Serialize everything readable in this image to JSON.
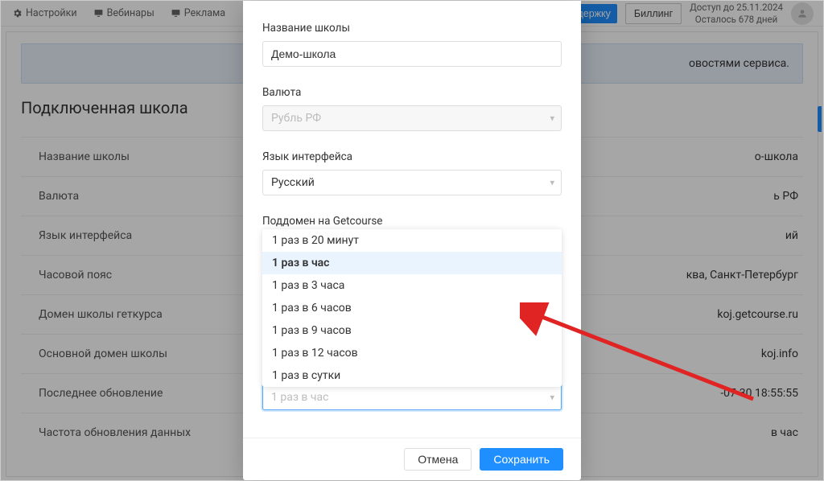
{
  "topbar": {
    "settings": "Настройки",
    "webinars": "Вебинары",
    "ads": "Реклама",
    "support_btn": "в поддержку",
    "billing_btn": "Биллинг",
    "access_line1": "Доступ до 25.11.2024",
    "access_line2": "Осталось 678 дней"
  },
  "banner_text": "овостями сервиса.",
  "page_title": "Подключенная школа",
  "rows": [
    {
      "label": "Название школы",
      "value": "о-школа"
    },
    {
      "label": "Валюта",
      "value": "ь РФ"
    },
    {
      "label": "Язык интерфейса",
      "value": "ий"
    },
    {
      "label": "Часовой пояс",
      "value": "ква, Санкт-Петербург"
    },
    {
      "label": "Домен школы геткурса",
      "value": "koj.getcourse.ru"
    },
    {
      "label": "Основной домен школы",
      "value": "koj.info"
    },
    {
      "label": "Последнее обновление",
      "value": "-07-30 18:55:55"
    },
    {
      "label": "Частота обновления данных",
      "value": "в час"
    }
  ],
  "modal": {
    "school_label": "Название школы",
    "school_value": "Демо-школа",
    "currency_label": "Валюта",
    "currency_value": "Рубль РФ",
    "lang_label": "Язык интерфейса",
    "lang_value": "Русский",
    "subdomain_label": "Поддомен на Getcourse",
    "freq_placeholder": "1 раз в час",
    "options": [
      "1 раз в 20 минут",
      "1 раз в час",
      "1 раз в 3 часа",
      "1 раз в 6 часов",
      "1 раз в 9 часов",
      "1 раз в 12 часов",
      "1 раз в сутки"
    ],
    "cancel": "Отмена",
    "save": "Сохранить"
  }
}
